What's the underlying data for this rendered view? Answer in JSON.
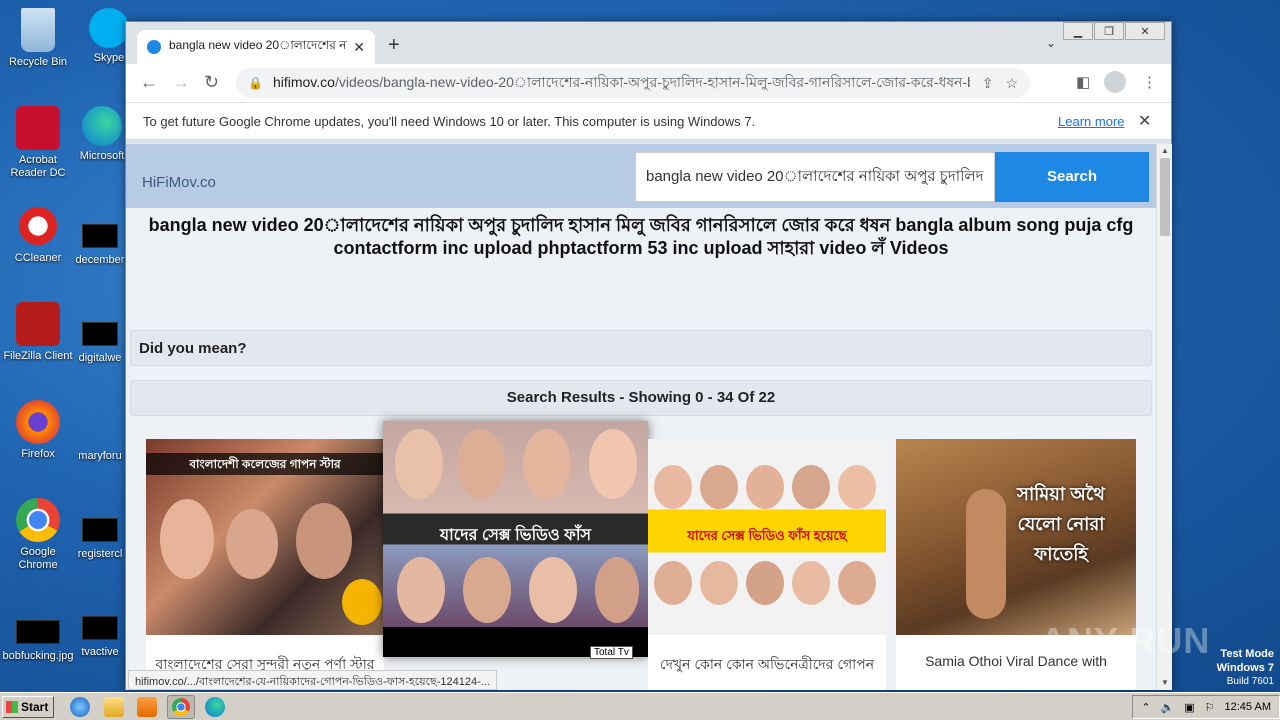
{
  "desktop": {
    "icons_col1": [
      "Recycle Bin",
      "Acrobat Reader DC",
      "CCleaner",
      "FileZilla Client",
      "Firefox",
      "Google Chrome",
      "bobfucking.jpg"
    ],
    "icons_col2": [
      "Skype",
      "Microsoft",
      "december",
      "digitalwe",
      "maryforu",
      "registercl",
      "tvactive"
    ]
  },
  "browser": {
    "tab_title": "bangla new video 20ালাদেশের নায়িক",
    "url_host": "hifimov.co",
    "url_path": "/videos/bangla-new-video-20ালাদেশের-নায়িকা-অপুর-চুদালিদ-হাসান-মিলু-জবির-গানরিসালে-জোর-করে-ধষন-bangla-...",
    "infobar_message": "To get future Google Chrome updates, you'll need Windows 10 or later. This computer is using Windows 7.",
    "infobar_link": "Learn more",
    "status_url": "hifimov.co/.../বাংলাদেশের-যে-নায়িকাদের-গোপন-ভিডিও-ফাস-হয়েছে-124124-..."
  },
  "site": {
    "logo": "HiFiMov.co",
    "search_value": "bangla new video 20ালাদেশের নায়িকা অপুর চুদালিদ",
    "search_button": "Search",
    "title": "bangla new video 20ালাদেশের নায়িকা অপুর চুদালিদ হাসান মিলু জবির গানরিসালে জোর করে ধষন bangla album song puja cfg contactform inc upload phptactform 53 inc upload সাহারা video লঁ Videos",
    "did_you_mean": "Did you mean?",
    "results_header": "Search Results - Showing 0 - 34 Of 22",
    "cards": [
      {
        "caption": "বাংলাদেশের সেরা সুন্দরী নতুন পর্ণা স্টার"
      },
      {
        "caption": "নায়িকাদের গোপন ভিডিও"
      },
      {
        "caption": "দেখুন কোন কোন অভিনেত্রীদের গোপন"
      },
      {
        "caption": "Samia Othoi Viral Dance with"
      }
    ],
    "card1_banner": "বাংলাদেশী কলেজের গাপন স্টার",
    "card2_banner": "যাদের সেক্স ভিডিও ফাঁস",
    "card3_banner": "যাদের সেক্স ভিডিও ফাঁস হয়েছে",
    "card4_overlay": "সামিয়া অথৈ যেলো নোরা ফাতেহি",
    "tooltip": "Total Tv"
  },
  "overlay": {
    "watermark": "ANY RUN",
    "test_mode": "Test Mode",
    "os": "Windows 7",
    "build": "Build 7601"
  },
  "taskbar": {
    "start": "Start",
    "clock": "12:45 AM"
  }
}
